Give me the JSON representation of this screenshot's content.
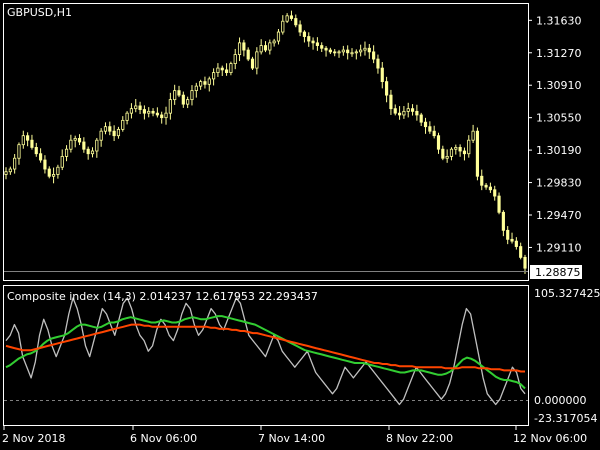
{
  "main_chart": {
    "symbol_label": "GBPUSD,H1",
    "current_price_label": "1.28875",
    "price_ticks": [
      "1.31630",
      "1.31270",
      "1.30910",
      "1.30550",
      "1.30190",
      "1.29830",
      "1.29470",
      "1.29110"
    ],
    "price_tick_values": [
      1.3163,
      1.3127,
      1.3091,
      1.3055,
      1.3019,
      1.2983,
      1.2947,
      1.2911
    ],
    "colors": {
      "background": "#000000",
      "candles": "#ffff99",
      "frame": "#ffffff",
      "price_label_bg": "#ffffff",
      "price_label_text": "#000000"
    }
  },
  "indicator": {
    "label": "Composite index (14,3) 2.014237 12.617953 22.293437",
    "axis_ticks": [
      "105.327425",
      "0.000000",
      "-23.317054"
    ],
    "axis_tick_values": [
      105.327425,
      0.0,
      -23.317054
    ],
    "colors": {
      "composite": "#c0c0c0",
      "fast_ma": "#32cd32",
      "slow_ma": "#ff4500",
      "zero_line": "#808080"
    }
  },
  "time_axis": {
    "labels": [
      "2 Nov 2018",
      "6 Nov 06:00",
      "7 Nov 14:00",
      "8 Nov 22:00",
      "12 Nov 06:00"
    ]
  },
  "chart_data": [
    {
      "type": "candlestick",
      "title": "GBPUSD,H1",
      "ylim": [
        1.2876,
        1.318
      ],
      "x_labels": [
        "2 Nov 2018",
        "6 Nov 06:00",
        "7 Nov 14:00",
        "8 Nov 22:00",
        "12 Nov 06:00"
      ],
      "close_series": [
        1.2995,
        1.2998,
        1.301,
        1.3025,
        1.3035,
        1.303,
        1.3022,
        1.3015,
        1.3008,
        1.2998,
        1.299,
        1.2992,
        1.3,
        1.3012,
        1.302,
        1.303,
        1.3032,
        1.3028,
        1.302,
        1.3015,
        1.3018,
        1.303,
        1.304,
        1.3045,
        1.304,
        1.3035,
        1.3042,
        1.3052,
        1.306,
        1.3065,
        1.3068,
        1.3064,
        1.306,
        1.3062,
        1.306,
        1.3058,
        1.3055,
        1.306,
        1.3075,
        1.3085,
        1.308,
        1.307,
        1.3075,
        1.3085,
        1.309,
        1.3095,
        1.3092,
        1.3098,
        1.3105,
        1.311,
        1.3108,
        1.3105,
        1.3115,
        1.3125,
        1.3138,
        1.313,
        1.312,
        1.311,
        1.3128,
        1.3135,
        1.313,
        1.3138,
        1.314,
        1.315,
        1.3162,
        1.3168,
        1.3165,
        1.3158,
        1.315,
        1.3145,
        1.314,
        1.3138,
        1.3135,
        1.3132,
        1.313,
        1.3128,
        1.3127,
        1.3128,
        1.313,
        1.3127,
        1.3127,
        1.3128,
        1.313,
        1.3132,
        1.3128,
        1.312,
        1.311,
        1.3095,
        1.308,
        1.3065,
        1.306,
        1.3058,
        1.3062,
        1.3065,
        1.3062,
        1.3058,
        1.305,
        1.3045,
        1.304,
        1.3035,
        1.302,
        1.301,
        1.3012,
        1.302,
        1.3022,
        1.3018,
        1.3015,
        1.303,
        1.304,
        1.299,
        1.298,
        1.2978,
        1.2975,
        1.2968,
        1.295,
        1.293,
        1.292,
        1.2918,
        1.2912,
        1.29,
        1.2888
      ],
      "composite_index_values": [
        {
          "series": "composite",
          "ylim": [
            -23.317054,
            105.327425
          ],
          "values": [
            55,
            60,
            70,
            62,
            40,
            30,
            20,
            35,
            60,
            75,
            65,
            50,
            40,
            50,
            60,
            80,
            95,
            85,
            70,
            50,
            40,
            55,
            70,
            85,
            80,
            70,
            60,
            75,
            90,
            95,
            85,
            70,
            60,
            55,
            45,
            50,
            65,
            75,
            70,
            60,
            55,
            65,
            80,
            90,
            85,
            70,
            60,
            65,
            75,
            85,
            80,
            70,
            65,
            75,
            85,
            95,
            90,
            75,
            60,
            55,
            50,
            45,
            40,
            50,
            60,
            55,
            45,
            40,
            35,
            30,
            35,
            40,
            45,
            35,
            25,
            20,
            15,
            10,
            5,
            10,
            20,
            30,
            25,
            20,
            25,
            30,
            35,
            30,
            25,
            20,
            15,
            10,
            5,
            0,
            -5,
            0,
            10,
            20,
            30,
            25,
            20,
            15,
            10,
            5,
            0,
            5,
            15,
            30,
            50,
            70,
            85,
            80,
            60,
            40,
            20,
            5,
            0,
            -5,
            0,
            10,
            20,
            30,
            25,
            10,
            5
          ]
        },
        {
          "series": "fast_ma",
          "values": [
            30,
            32,
            35,
            38,
            40,
            42,
            43,
            45,
            48,
            52,
            55,
            57,
            58,
            59,
            60,
            62,
            65,
            68,
            70,
            70,
            69,
            68,
            67,
            68,
            70,
            72,
            72,
            73,
            75,
            76,
            77,
            76,
            75,
            74,
            73,
            72,
            72,
            73,
            74,
            73,
            72,
            72,
            73,
            75,
            76,
            77,
            76,
            75,
            75,
            76,
            77,
            78,
            78,
            77,
            76,
            75,
            74,
            73,
            72,
            71,
            70,
            68,
            66,
            64,
            62,
            60,
            58,
            56,
            54,
            52,
            50,
            48,
            46,
            45,
            44,
            43,
            42,
            41,
            40,
            39,
            38,
            37,
            36,
            35,
            34,
            34,
            34,
            33,
            32,
            31,
            30,
            29,
            28,
            27,
            26,
            25,
            25,
            26,
            27,
            27,
            27,
            26,
            25,
            24,
            23,
            23,
            24,
            26,
            29,
            33,
            37,
            39,
            38,
            36,
            33,
            30,
            27,
            24,
            21,
            19,
            18,
            18,
            17,
            16,
            14,
            10
          ]
        },
        {
          "series": "slow_ma",
          "values": [
            50,
            49,
            48,
            47,
            46,
            46,
            46,
            47,
            48,
            49,
            50,
            51,
            52,
            53,
            54,
            55,
            56,
            57,
            58,
            59,
            60,
            61,
            62,
            63,
            64,
            65,
            66,
            67,
            68,
            69,
            70,
            70,
            70,
            69,
            69,
            68,
            68,
            68,
            68,
            68,
            68,
            68,
            68,
            68,
            68,
            68,
            68,
            68,
            68,
            67,
            67,
            66,
            66,
            66,
            65,
            65,
            64,
            64,
            63,
            62,
            62,
            61,
            60,
            59,
            58,
            57,
            56,
            55,
            54,
            53,
            52,
            51,
            50,
            49,
            48,
            47,
            46,
            45,
            44,
            43,
            42,
            41,
            40,
            39,
            38,
            37,
            36,
            35,
            34,
            34,
            33,
            33,
            32,
            32,
            31,
            31,
            31,
            31,
            30,
            30,
            30,
            30,
            30,
            30,
            30,
            29,
            29,
            29,
            29,
            30,
            30,
            30,
            30,
            29,
            29,
            29,
            28,
            28,
            28,
            27,
            27,
            27,
            27,
            26,
            26
          ]
        }
      ]
    }
  ]
}
